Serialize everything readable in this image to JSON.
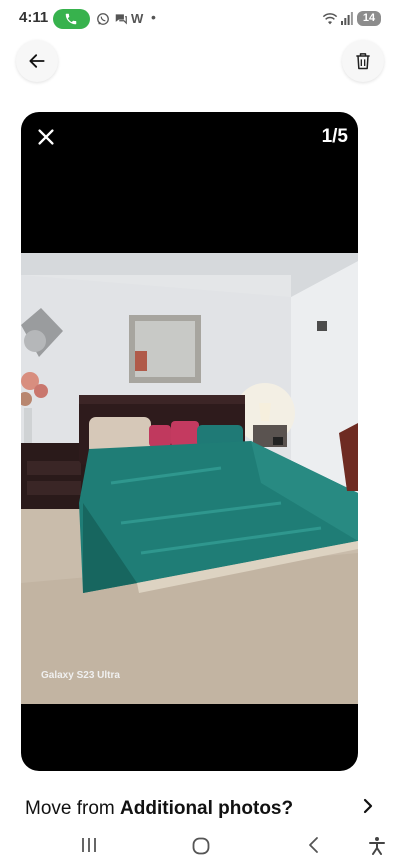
{
  "status_bar": {
    "time": "4:11",
    "battery": "14",
    "notif_letter": "W",
    "notif_dot": "•",
    "accent_call": "#37b24d"
  },
  "toolbar": {
    "back_icon": "arrow-left-icon",
    "delete_icon": "trash-icon"
  },
  "viewer": {
    "counter": "1/5",
    "close_icon": "close-icon",
    "photo_watermark": "Galaxy S23 Ultra"
  },
  "prompt": {
    "text_prefix": "Move from ",
    "text_bold": "Additional photos",
    "text_suffix": "?",
    "chevron_icon": "chevron-right-icon"
  },
  "nav_bar": {
    "recents_icon": "recents-icon",
    "home_icon": "home-icon",
    "back_icon": "back-icon",
    "accessibility_icon": "accessibility-icon"
  }
}
